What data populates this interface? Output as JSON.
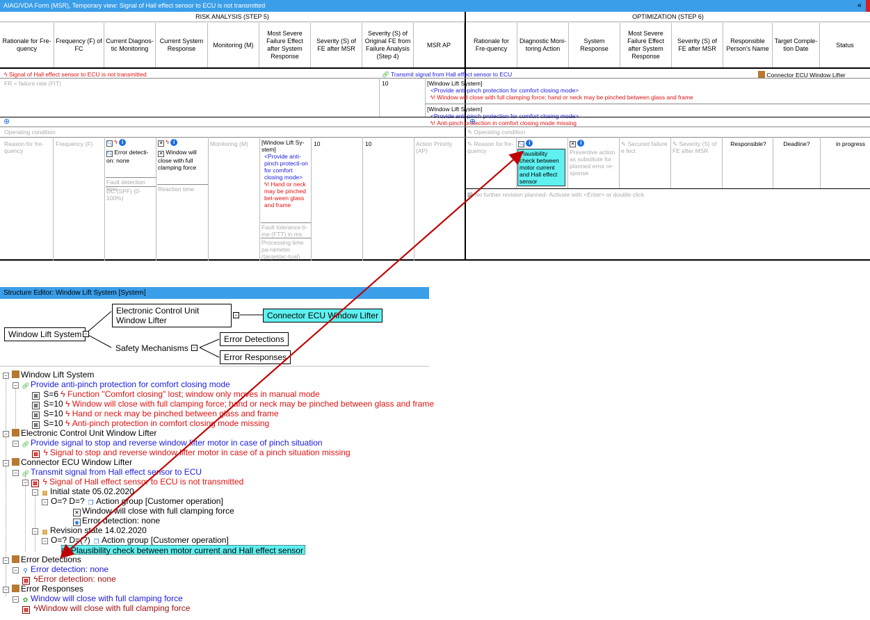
{
  "window_title": "AIAG/VDA Form (MSR), Temporary view: Signal of Hall effect sensor to ECU is not transmitted",
  "collapse_glyph": "«",
  "risk_analysis": {
    "header": "RISK ANALYSIS (STEP 5)",
    "columns": [
      "Rationale for Fre-quency",
      "Frequency (F) of FC",
      "Current Diagnos-tic Monitoring",
      "Current System Response",
      "Monitoring (M)",
      "Most Severe Failure Effect after System Response",
      "Severity (S) of FE after MSR",
      "Severity (S) of Original FE from Failure Analysis (Step 4)",
      "MSR AP"
    ]
  },
  "optimization": {
    "header": "OPTIMIZATION  (STEP 6)",
    "columns": [
      "Rationale for Fre-quency",
      "Diagnostic Moni-toring Action",
      "System Response",
      "Most Severe Failure Effect after System Response",
      "Severity (S) of FE after MSR",
      "Responsible Person's Name",
      "Target Comple-tion Date",
      "Status"
    ]
  },
  "row1": {
    "failure_cause": "Signal of Hall effect sensor to ECU is not transmitted",
    "function": "Transmit signal from Hall effect sensor to ECU",
    "element": "Connector ECU Window Lifter",
    "fr_placeholder": "FR = failure rate (FIT)",
    "severity": "10",
    "effects": [
      {
        "system": "[Window Lift System]",
        "function": "<Provide anti-pinch protection for comfort closing mode>",
        "effect": "Window will close with full clamping force; hand or neck may be pinched between glass and frame"
      },
      {
        "system": "[Window Lift System]",
        "function": "<Provide anti-pinch protection for comfort closing mode>",
        "effect": "Anti-pinch protection in comfort closing mode missing"
      }
    ]
  },
  "row2": {
    "operating_condition": "Operating condition",
    "reason_placeholder": "Reason for fre-quency",
    "frequency_placeholder": "Frequency (F)",
    "error_detection": "Error detecti-on: none",
    "fault_detection_time": "Fault detection time",
    "dc_placeholder": "DC (SPF) (0-100%)",
    "system_response": "Window will close with full clamping force",
    "reaction_time": "Reaction time",
    "monitoring_placeholder": "Monitoring (M)",
    "most_severe_system": "[Window Lift Sy-stem]",
    "most_severe_function": "<Provide anti-pinch protecti-on for comfort closing mode>",
    "most_severe_effect": "Hand or neck may be pinched bet-ween glass and frame",
    "ftt_placeholder": "Fault tolerance ti-me (FTT) in ms",
    "processing_placeholder": "Processing time pa-rameter (target/ac-tual)",
    "sev_after_msr": "10",
    "sev_original": "10",
    "ap_placeholder": "Action Priority (AP)"
  },
  "opt_row": {
    "operating_condition": "Operating condition",
    "reason_placeholder": "Reason for fre-quency",
    "action": "Plausibility check between motor current and Hall effect sensor",
    "preventive_placeholder": "Preventive action as substitute for planned error re-sponse",
    "secured_placeholder": "Secured failure e fect",
    "severity_placeholder": "Severity (S) of FE after MSR",
    "responsible": "Responsible?",
    "deadline": "Deadline?",
    "status": "in progress",
    "revision_note": "No further revision planned- Activate with <Enter> or double click"
  },
  "structure_editor": {
    "title": "Structure Editor: Window Lift System [System]",
    "root": "Window Lift System",
    "ecu": "Electronic Control Unit Window Lifter",
    "connector": "Connector ECU Window Lifter",
    "safety": "Safety Mechanisms",
    "detections": "Error Detections",
    "responses": "Error Responses"
  },
  "tree": [
    "Window Lift System",
    "Provide anti-pinch protection for comfort closing mode",
    "S=6",
    "Function \"Comfort closing\" lost; window only moves in manual mode",
    "S=10",
    "Window will close with full clamping force; hand or neck may be pinched between glass and frame",
    "S=10",
    "Hand or neck may be pinched between glass and frame",
    "S=10",
    "Anti-pinch protection in comfort closing mode missing",
    "Electronic Control Unit Window Lifter",
    "Provide signal to stop and reverse window lifter motor in case of pinch situation",
    "Signal to stop and reverse window lifter motor in case of a pinch situation missing",
    "Connector ECU Window Lifter",
    "Transmit signal from Hall effect sensor to ECU",
    "Signal of Hall effect sensor to ECU is not transmitted",
    "Initial state 05.02.2020",
    "O=? D=?",
    "Action group [Customer operation]",
    "Window will close with full clamping force",
    "Error detection: none",
    "Revision state 14.02.2020",
    "O=? D=(?)",
    "Action group [Customer operation]",
    "Plausibility check between motor current and Hall effect sensor",
    "Error Detections",
    "Error detection: none",
    "Error detection: none",
    "Error Responses",
    "Window will close with full clamping force",
    "Window will close with full clamping force"
  ],
  "colors": {
    "titlebar": "#3b9ee8",
    "failure_red": "#e01010",
    "function_blue": "#1a1ae0",
    "selection_cyan": "#5ff0f0",
    "arrow": "#c00000"
  }
}
